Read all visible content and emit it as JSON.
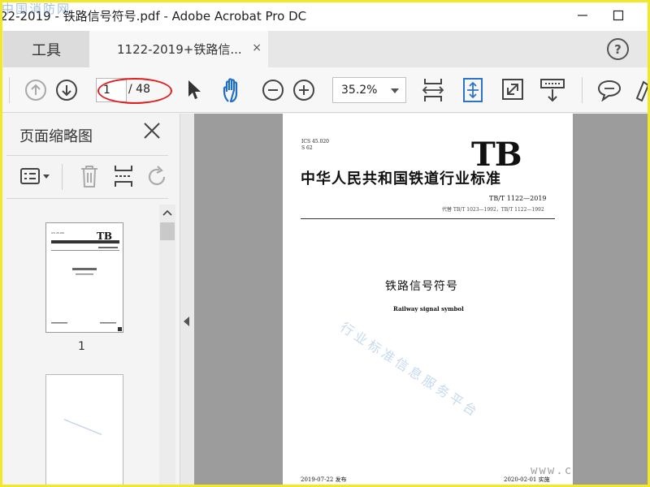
{
  "window": {
    "title": "22-2019 - 铁路信号符号.pdf - Adobe Acrobat Pro DC",
    "watermark": "中国消防网"
  },
  "tabs": {
    "tools_label": "工具",
    "document_label": "1122-2019+铁路信...",
    "close_glyph": "×",
    "help_glyph": "?"
  },
  "toolbar": {
    "page_current": "1",
    "page_total": "/ 48",
    "zoom": "35.2%",
    "highlight_color": "#e02020"
  },
  "sidebar": {
    "title": "页面缩略图",
    "thumbnails": [
      {
        "label": "1"
      }
    ]
  },
  "document": {
    "ics_line1": "ICS 45.020",
    "ics_line2": "S 62",
    "logo": "TB",
    "standard_name": "中华人民共和国铁道行业标准",
    "code": "TB/T 1122—2019",
    "replaces": "代替 TB/T 1023—1992，TB/T 1122—1992",
    "title_cn": "铁路信号符号",
    "title_en": "Railway signal symbol",
    "published": "2019-07-22 发布",
    "implemented": "2020-02-01 实施",
    "watermark_diag": "行业标准信息服务平台",
    "watermark_www": "www.c"
  },
  "colors": {
    "background": "#f4f4f4",
    "doc_gray": "#9c9c9c",
    "frame": "#f2e829",
    "accent_blue": "#2a74c9"
  }
}
